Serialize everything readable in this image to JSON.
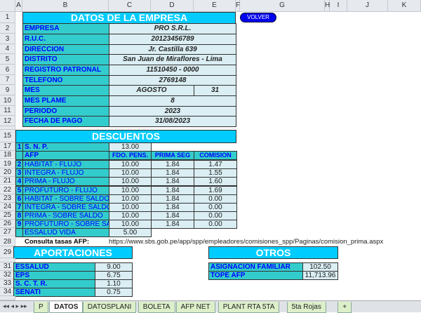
{
  "columns": [
    "A",
    "B",
    "C",
    "D",
    "E",
    "F",
    "G",
    "H",
    "I",
    "J",
    "K"
  ],
  "empresa": {
    "title": "DATOS DE LA EMPRESA",
    "rows": [
      {
        "row": "2",
        "label": "EMPRESA",
        "value": "PRO S.R.L."
      },
      {
        "row": "3",
        "label": "R.U.C.",
        "value": "20123456789"
      },
      {
        "row": "4",
        "label": "DIRECCION",
        "value": "Jr. Castilla 639"
      },
      {
        "row": "5",
        "label": "DISTRITO",
        "value": "San Juan de Miraflores - Lima"
      },
      {
        "row": "6",
        "label": "REGISTRO PATRONAL",
        "value": "11510450 - 0000"
      },
      {
        "row": "7",
        "label": "TELEFONO",
        "value": "2769148"
      },
      {
        "row": "9",
        "label": "MES",
        "value": "AGOSTO",
        "extra": "31"
      },
      {
        "row": "10",
        "label": "MES PLAME",
        "value": "8"
      },
      {
        "row": "11",
        "label": "PERIODO",
        "value": "2023"
      },
      {
        "row": "12",
        "label": "FECHA DE PAGO",
        "value": "31/08/2023"
      }
    ]
  },
  "volver_label": "VOLVER",
  "descuentos": {
    "title": "DESCUENTOS",
    "snp": {
      "num": "1",
      "label": "S. N. P.",
      "value": "13.00"
    },
    "afp_label": "AFP",
    "headers": [
      "FDO. PENS.",
      "PRIMA SEG",
      "COMISION"
    ],
    "rows": [
      {
        "row": "19",
        "num": "2",
        "label": "HABITAT - FLUJO",
        "values": [
          "10.00",
          "1.84",
          "1.47"
        ]
      },
      {
        "row": "20",
        "num": "3",
        "label": "INTEGRA - FLUJO",
        "values": [
          "10.00",
          "1.84",
          "1.55"
        ]
      },
      {
        "row": "21",
        "num": "4",
        "label": "PRIMA - FLUJO",
        "values": [
          "10.00",
          "1.84",
          "1.60"
        ]
      },
      {
        "row": "22",
        "num": "5",
        "label": "PROFUTURO - FLUJO",
        "values": [
          "10.00",
          "1.84",
          "1.69"
        ]
      },
      {
        "row": "23",
        "num": "6",
        "label": "HABITAT - SOBRE SALDO",
        "values": [
          "10.00",
          "1.84",
          "0.00"
        ]
      },
      {
        "row": "24",
        "num": "7",
        "label": "INTEGRA - SOBRE SALDO",
        "values": [
          "10.00",
          "1.84",
          "0.00"
        ]
      },
      {
        "row": "25",
        "num": "8",
        "label": "PRIMA - SOBRE SALDO",
        "values": [
          "10.00",
          "1.84",
          "0.00"
        ]
      },
      {
        "row": "26",
        "num": "9",
        "label": "PROFUTURO - SOBRE SALDO",
        "values": [
          "10.00",
          "1.84",
          "0.00"
        ]
      }
    ],
    "essalud_vida": {
      "label": "ESSALUD VIDA",
      "value": "5.00"
    }
  },
  "consulta": {
    "label": "Consulta tasas AFP:",
    "url": "https://www.sbs.gob.pe/app/spp/empleadores/comisiones_spp/Paginas/comision_prima.aspx"
  },
  "aportaciones": {
    "title": "APORTACIONES",
    "rows": [
      {
        "row": "31",
        "label": "ESSALUD",
        "value": "9.00"
      },
      {
        "row": "32",
        "label": "EPS",
        "value": "6.75"
      },
      {
        "row": "33",
        "label": "S. C. T. R.",
        "value": "1.10"
      },
      {
        "row": "34",
        "label": "SENATI",
        "value": "0.75"
      }
    ]
  },
  "otros": {
    "title": "OTROS",
    "rows": [
      {
        "label": "ASIGNACION FAMILIAR",
        "value": "102.50"
      },
      {
        "label": "TOPE AFP",
        "value": "11,713.96"
      }
    ]
  },
  "row_numbers": {
    "r1": "1",
    "r15": "15",
    "r17": "17",
    "r18": "18",
    "r27": "27",
    "r28": "28",
    "r29": "29"
  },
  "tabs": [
    "P",
    "DATOS",
    "DATOSPLANI",
    "BOLETA",
    "AFP NET",
    "PLANT RTA 5TA",
    "5ta Rojas"
  ],
  "active_tab": "DATOS"
}
